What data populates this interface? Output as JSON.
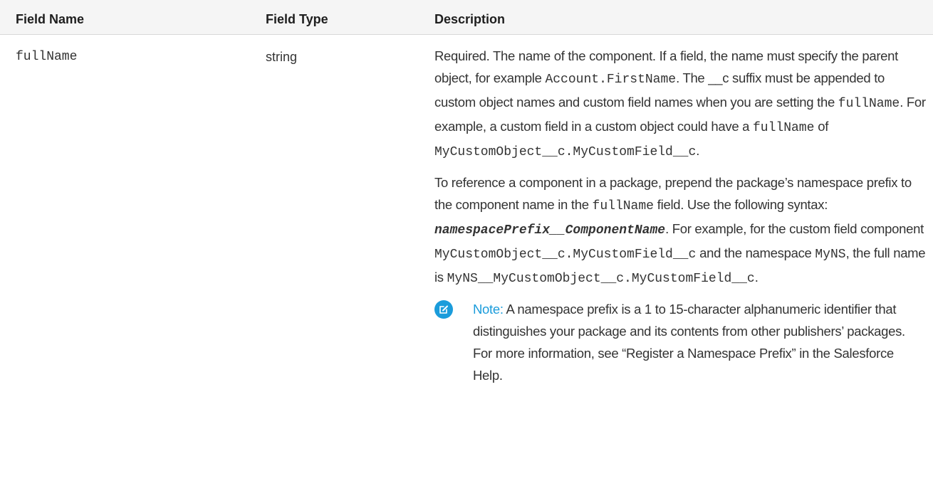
{
  "table": {
    "headers": {
      "field_name": "Field Name",
      "field_type": "Field Type",
      "description": "Description"
    },
    "row": {
      "field_name": "fullName",
      "field_type": "string",
      "description": {
        "p1": {
          "t1": "Required. The name of the component. If a field, the name must specify the parent object, for example ",
          "c1": "Account.FirstName",
          "t2": ". The __c suffix must be appended to custom object names and custom field names when you are setting the ",
          "c2": "fullName",
          "t3": ". For example, a custom field in a custom object could have a ",
          "c3": "fullName",
          "t4": " of ",
          "c4": "MyCustomObject__c.MyCustomField__c",
          "t5": "."
        },
        "p2": {
          "t1": "To reference a component in a package, prepend the package’s namespace prefix to the component name in the ",
          "c1": "fullName",
          "t2": " field. Use the following syntax: ",
          "c2": "namespacePrefix__ComponentName",
          "t3": ". For example, for the custom field component ",
          "c3": "MyCustomObject__c.MyCustomField__c",
          "t4": " and the namespace ",
          "c4": "MyNS",
          "t5": ", the full name is ",
          "c5": "MyNS__MyCustomObject__c.MyCustomField__c",
          "t6": "."
        },
        "note": {
          "icon": "edit-note-icon",
          "label": "Note:",
          "text": "A namespace prefix is a 1 to 15-character alphanumeric identifier that distinguishes your package and its contents from other publishers’ packages. For more information, see “Register a Namespace Prefix” in the Salesforce Help."
        }
      }
    }
  },
  "colors": {
    "accent": "#1b9cdb",
    "header_bg": "#f5f5f5",
    "text": "#333333"
  }
}
